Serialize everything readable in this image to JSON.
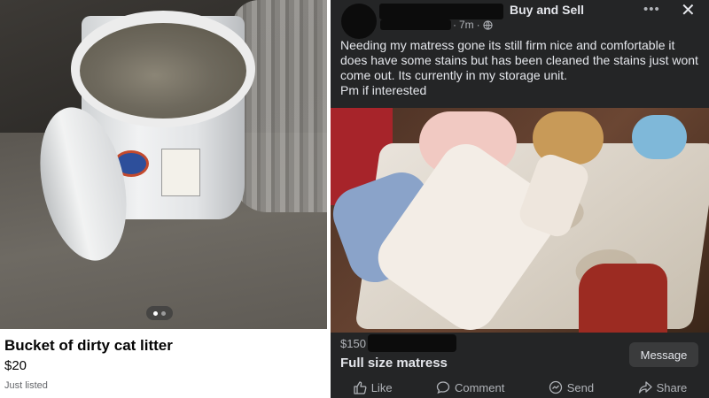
{
  "listing": {
    "title": "Bucket of dirty cat litter",
    "price": "$20",
    "status": "Just listed",
    "photo_count": 2,
    "photo_index": 1
  },
  "post": {
    "group_name": "Buy and Sell",
    "time": "7m",
    "privacy_icon": "globe-icon",
    "body": "Needing my matress gone its still firm nice and comfortable it does have some stains but has been cleaned the stains just wont come out. Its currently in my storage unit.\nPm if interested",
    "price": "$150",
    "item_title": "Full size matress",
    "message_label": "Message",
    "more_icon": "more-icon",
    "close_icon": "close-icon"
  },
  "actions": [
    {
      "label": "Like",
      "icon": "like-icon"
    },
    {
      "label": "Comment",
      "icon": "comment-icon"
    },
    {
      "label": "Send",
      "icon": "send-icon"
    },
    {
      "label": "Share",
      "icon": "share-icon"
    }
  ],
  "colors": {
    "post_background": "#242526",
    "text_primary": "#e4e6eb",
    "text_secondary": "#b0b3b8",
    "button_background": "#3a3b3c"
  }
}
